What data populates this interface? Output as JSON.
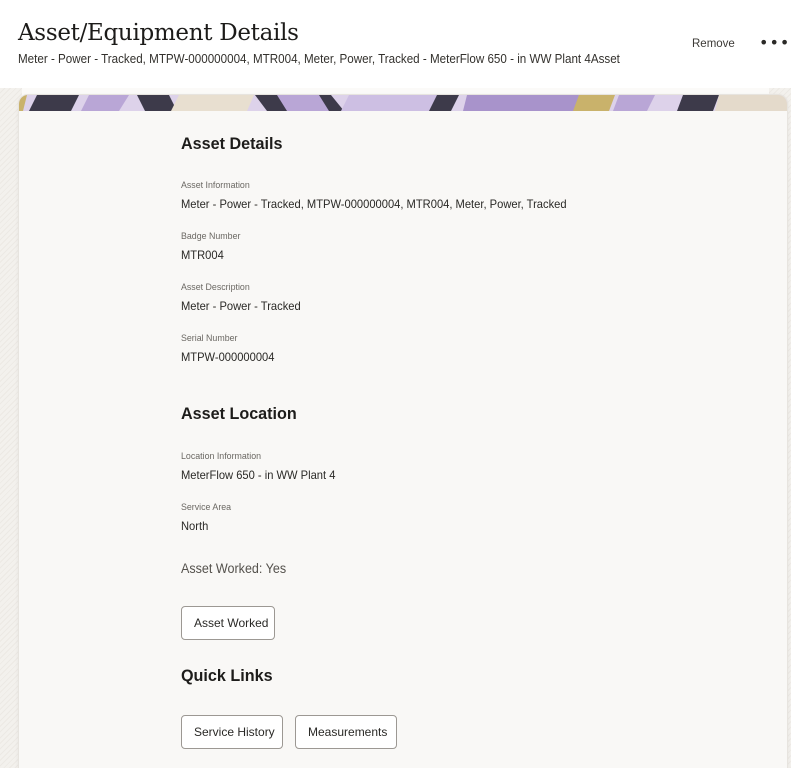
{
  "header": {
    "title": "Asset/Equipment Details",
    "subtitle": "Meter - Power - Tracked, MTPW-000000004, MTR004, Meter, Power, Tracked - MeterFlow 650 - in WW Plant 4Asset",
    "remove_label": "Remove",
    "more_label": "•••",
    "more_icon": "more-horizontal-icon"
  },
  "asset_details": {
    "title": "Asset Details",
    "fields": [
      {
        "label": "Asset Information",
        "value": "Meter - Power - Tracked, MTPW-000000004, MTR004, Meter, Power, Tracked"
      },
      {
        "label": "Badge Number",
        "value": "MTR004"
      },
      {
        "label": "Asset Description",
        "value": "Meter - Power - Tracked"
      },
      {
        "label": "Serial Number",
        "value": "MTPW-000000004"
      }
    ]
  },
  "asset_location": {
    "title": "Asset Location",
    "fields": [
      {
        "label": "Location Information",
        "value": "MeterFlow 650 - in WW Plant 4"
      },
      {
        "label": "Service Area",
        "value": "North"
      }
    ],
    "status": "Asset Worked: Yes",
    "asset_worked_button": "Asset Worked"
  },
  "quick_links": {
    "title": "Quick Links",
    "buttons": [
      "Service History",
      "Measurements"
    ]
  },
  "colors": {
    "banner_purple": "#b9a6d6",
    "banner_dark": "#3d3a4a",
    "banner_gold": "#c9b26b"
  }
}
